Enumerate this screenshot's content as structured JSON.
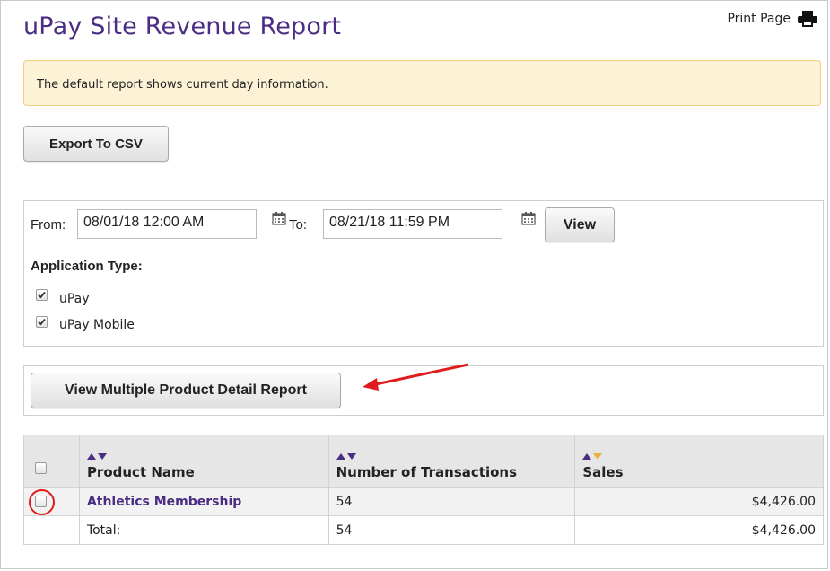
{
  "page": {
    "title": "uPay Site Revenue Report",
    "print_label": "Print Page",
    "notice": "The default report shows current day information.",
    "export_label": "Export To CSV"
  },
  "filter": {
    "from_label": "From:",
    "from_value": "08/01/18 12:00 AM",
    "to_label": "To:",
    "to_value": "08/21/18 11:59 PM",
    "view_label": "View",
    "app_type_label": "Application Type:",
    "app_types": [
      {
        "label": "uPay",
        "checked": true
      },
      {
        "label": "uPay Mobile",
        "checked": true
      }
    ]
  },
  "multi_report_label": "View Multiple Product Detail Report",
  "table": {
    "headers": [
      "Product Name",
      "Number of Transactions",
      "Sales"
    ],
    "rows": [
      {
        "product": "Athletics Membership",
        "transactions": "54",
        "sales": "$4,426.00"
      }
    ],
    "total": {
      "label": "Total:",
      "transactions": "54",
      "sales": "$4,426.00"
    }
  },
  "colors": {
    "accent": "#4b2e83",
    "notice_bg": "#fcf3d7",
    "annotation": "#e01b1b"
  }
}
